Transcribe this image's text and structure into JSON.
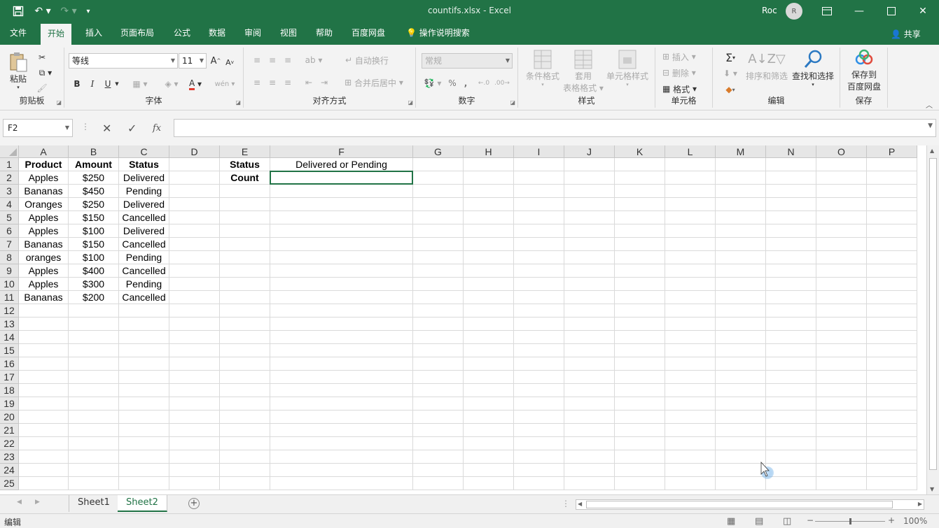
{
  "window": {
    "title": "countifs.xlsx  -  Excel",
    "user": "Roc",
    "avatar_initial": "R"
  },
  "menu": {
    "tabs": [
      "文件",
      "开始",
      "插入",
      "页面布局",
      "公式",
      "数据",
      "审阅",
      "视图",
      "帮助",
      "百度网盘"
    ],
    "active": "开始",
    "tell_me": "操作说明搜索",
    "share": "共享"
  },
  "ribbon": {
    "clipboard": {
      "paste": "粘贴",
      "label": "剪贴板"
    },
    "font": {
      "name": "等线",
      "size": "11",
      "bold": "B",
      "italic": "I",
      "underline": "U",
      "label": "字体"
    },
    "alignment": {
      "wrap": "自动换行",
      "merge": "合并后居中",
      "label": "对齐方式"
    },
    "number": {
      "format": "常规",
      "percent": "%",
      "comma": ",",
      "label": "数字"
    },
    "styles": {
      "conditional": "条件格式",
      "table1": "套用",
      "table2": "表格格式",
      "cell_styles": "单元格样式",
      "label": "样式"
    },
    "cells": {
      "insert": "插入",
      "delete": "删除",
      "format": "格式",
      "label": "单元格"
    },
    "editing": {
      "sort": "排序和筛选",
      "find": "查找和选择",
      "label": "编辑"
    },
    "save": {
      "line1": "保存到",
      "line2": "百度网盘",
      "label": "保存"
    }
  },
  "formula_bar": {
    "name_box": "F2",
    "fx": "fx",
    "formula": ""
  },
  "grid": {
    "columns": [
      "A",
      "B",
      "C",
      "D",
      "E",
      "F",
      "G",
      "H",
      "I",
      "J",
      "K",
      "L",
      "M",
      "N",
      "O",
      "P"
    ],
    "rows": [
      "1",
      "2",
      "3",
      "4",
      "5",
      "6",
      "7",
      "8",
      "9",
      "10",
      "11",
      "12",
      "13",
      "14",
      "15",
      "16",
      "17",
      "18",
      "19",
      "20",
      "21",
      "22",
      "23",
      "24",
      "25"
    ],
    "cells": [
      [
        "Product",
        "Amount",
        "Status",
        "",
        "Status",
        "Delivered or Pending"
      ],
      [
        "Apples",
        "$250",
        "Delivered",
        "",
        "Count",
        ""
      ],
      [
        "Bananas",
        "$450",
        "Pending",
        "",
        "",
        ""
      ],
      [
        "Oranges",
        "$250",
        "Delivered",
        "",
        "",
        ""
      ],
      [
        "Apples",
        "$150",
        "Cancelled",
        "",
        "",
        ""
      ],
      [
        "Apples",
        "$100",
        "Delivered",
        "",
        "",
        ""
      ],
      [
        "Bananas",
        "$150",
        "Cancelled",
        "",
        "",
        ""
      ],
      [
        "oranges",
        "$100",
        "Pending",
        "",
        "",
        ""
      ],
      [
        "Apples",
        "$400",
        "Cancelled",
        "",
        "",
        ""
      ],
      [
        "Apples",
        "$300",
        "Pending",
        "",
        "",
        ""
      ],
      [
        "Bananas",
        "$200",
        "Cancelled",
        "",
        "",
        ""
      ]
    ],
    "selected_cell": "F2"
  },
  "sheets": {
    "tabs": [
      "Sheet1",
      "Sheet2"
    ],
    "active": "Sheet2"
  },
  "status": {
    "mode": "编辑",
    "zoom": "100%"
  },
  "colors": {
    "brand": "#217346"
  }
}
